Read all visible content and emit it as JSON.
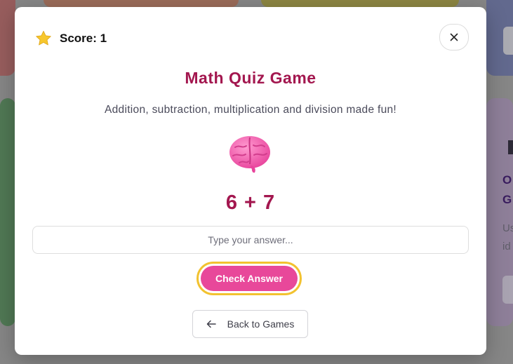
{
  "modal": {
    "score_label": "Score: 1",
    "title": "Math Quiz Game",
    "subtitle": "Addition, subtraction, multiplication and division made fun!",
    "question": "6 + 7",
    "answer_placeholder": "Type your answer...",
    "answer_value": "",
    "check_button": "Check Answer",
    "back_button": "Back to Games",
    "icons": [
      "star-icon",
      "close-icon",
      "brain-icon",
      "arrow-left-icon"
    ]
  },
  "background": {
    "partial_card_title": "O\nG",
    "partial_card_text": "Us\nid"
  },
  "colors": {
    "accent": "#a3174f",
    "check_button": "#e8489a",
    "check_button_ring": "#f2c230"
  }
}
